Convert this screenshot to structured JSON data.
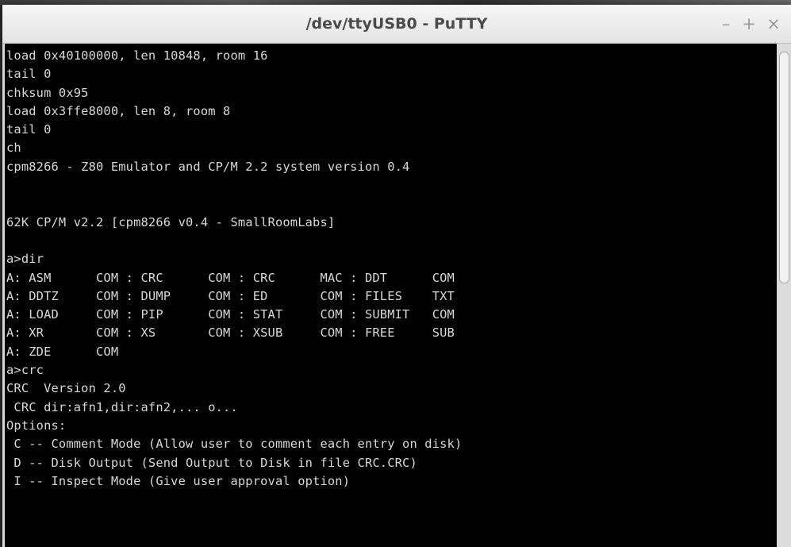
{
  "window": {
    "title": "/dev/ttyUSB0 - PuTTY",
    "minimize_symbol": "–",
    "maximize_symbol": "+",
    "close_symbol": "×"
  },
  "terminal": {
    "lines": [
      "load 0x40100000, len 10848, room 16",
      "tail 0",
      "chksum 0x95",
      "load 0x3ffe8000, len 8, room 8",
      "tail 0",
      "ch",
      "cpm8266 - Z80 Emulator and CP/M 2.2 system version 0.4",
      "",
      "",
      "62K CP/M v2.2 [cpm8266 v0.4 - SmallRoomLabs]",
      "",
      "a>dir",
      "A: ASM      COM : CRC      COM : CRC      MAC : DDT      COM",
      "A: DDTZ     COM : DUMP     COM : ED       COM : FILES    TXT",
      "A: LOAD     COM : PIP      COM : STAT     COM : SUBMIT   COM",
      "A: XR       COM : XS       COM : XSUB     COM : FREE     SUB",
      "A: ZDE      COM",
      "a>crc",
      "CRC  Version 2.0",
      " CRC dir:afn1,dir:afn2,... o...",
      "Options:",
      " C -- Comment Mode (Allow user to comment each entry on disk)",
      " D -- Disk Output (Send Output to Disk in file CRC.CRC)",
      " I -- Inspect Mode (Give user approval option)"
    ]
  }
}
